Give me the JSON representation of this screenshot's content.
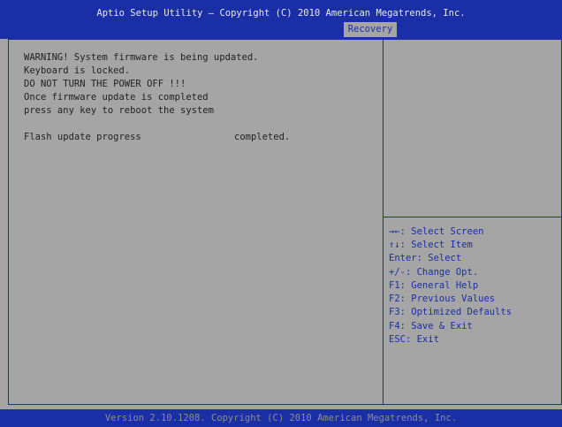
{
  "header": {
    "title": "Aptio Setup Utility – Copyright (C) 2010 American Megatrends, Inc.",
    "active_tab": "Recovery"
  },
  "main": {
    "messages": [
      "WARNING! System firmware is being updated.",
      "Keyboard is locked.",
      "DO NOT TURN THE POWER OFF !!!",
      "Once firmware update is completed",
      "press any key to reboot the system"
    ],
    "progress_label": "Flash update progress",
    "progress_status": "completed."
  },
  "help": {
    "items": [
      "→←: Select Screen",
      "↑↓: Select Item",
      "Enter: Select",
      "+/-: Change Opt.",
      "F1: General Help",
      "F2: Previous Values",
      "F3: Optimized Defaults",
      "F4: Save & Exit",
      "ESC: Exit"
    ]
  },
  "footer": {
    "version": "Version 2.10.1208. Copyright (C) 2010 American Megatrends, Inc."
  },
  "colors": {
    "background": "#a5a5a5",
    "bar_blue": "#1a2fa6",
    "text_dark": "#222222",
    "help_text": "#1a2fa6",
    "footer_text": "#8c8c8c"
  }
}
